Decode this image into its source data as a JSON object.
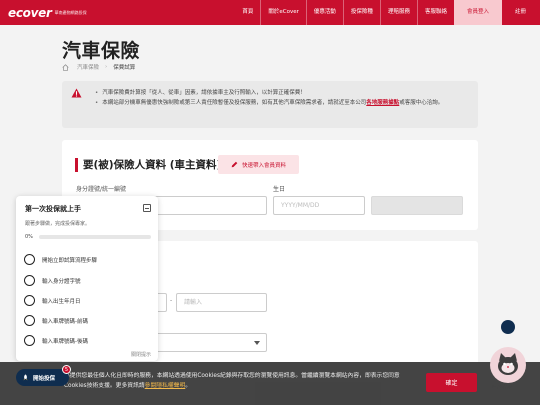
{
  "header": {
    "logo_mark": "ecover",
    "logo_sub": "華南產物網路投保",
    "nav": [
      "首頁",
      "關於eCover",
      "優惠活動",
      "投保險種",
      "理賠服務",
      "客服聯絡"
    ],
    "login": "會員登入",
    "register": "註冊"
  },
  "page": {
    "title": "汽車保險",
    "breadcrumb": [
      "汽車保險",
      "保費試算"
    ]
  },
  "notice": {
    "line1": "汽車保險費計算按「從人、從車」因素，請依據車主及行照輸入，以計算正確保費！",
    "line2_pre": "本網站部分機車無優惠快強制險或第三人責任險暫僅及投保服務，如有其他汽車保險需求者，請就近至本公司",
    "line2_link": "各地服務據點",
    "line2_post": "或客服中心洽詢。"
  },
  "form": {
    "section_title": "要(被)保險人資料 (車主資料)",
    "quick_button": "快速帶入會員資料",
    "id_label": "身分證號/統一編號",
    "dob_label": "生日",
    "dob_placeholder": "YYYY/MM/DD",
    "plate_placeholder": "請輸入"
  },
  "guide": {
    "title": "第一次投保就上手",
    "subtitle": "跟著步驟做，完成投保專家。",
    "progress_label": "0%",
    "progress": 0,
    "steps": [
      "開始立即試算流程步驟",
      "輸入身分證字號",
      "輸入出生年月日",
      "輸入車牌號碼-前碼",
      "輸入車牌號碼-後碼"
    ],
    "close": "關閉提示"
  },
  "start_button": {
    "label": "開始投保",
    "badge": "5"
  },
  "cookie": {
    "text": "為提供您最佳個人化且即時的服務，本網站透過使用Cookies紀錄與存取您的瀏覽使用訊息。當繼續瀏覽本網站內容，即表示您同意Cookies技術支援。更多資訊請",
    "link": "參閱隱私權聲明",
    "text_end": "。",
    "button": "確定"
  },
  "chat": {
    "label": "智能客服"
  }
}
